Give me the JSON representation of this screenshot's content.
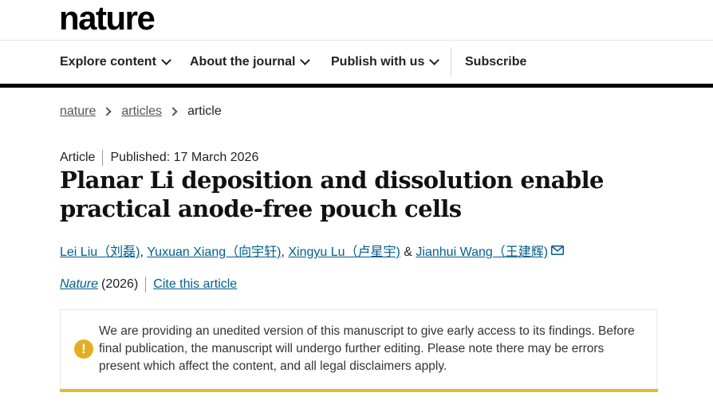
{
  "brand": {
    "logo_text": "nature"
  },
  "nav": {
    "items": [
      {
        "label": "Explore content"
      },
      {
        "label": "About the journal"
      },
      {
        "label": "Publish with us"
      }
    ],
    "subscribe_label": "Subscribe"
  },
  "breadcrumb": [
    "nature",
    "articles",
    "article"
  ],
  "article": {
    "type": "Article",
    "published": "Published: 17 March 2026",
    "title": "Planar Li deposition and dissolution enable practical anode-free pouch cells",
    "authors": [
      "Lei Liu（刘磊)",
      "Yuxuan Xiang（向宇轩)",
      "Xingyu Lu（卢星宇)",
      "Jianhui Wang（王建辉)"
    ],
    "author_sep": ", ",
    "author_and": " & ",
    "journal": "Nature",
    "year": "(2026)",
    "cite_label": "Cite this article"
  },
  "notice": {
    "icon": "exclamation-icon",
    "text": "We are providing an unedited version of this manuscript to give early access to its findings. Before final publication, the manuscript will undergo further editing. Please note there may be errors present which affect the content, and all legal disclaimers apply."
  },
  "colors": {
    "link": "#025e8d",
    "accent": "#e8b830",
    "text": "#222222"
  }
}
